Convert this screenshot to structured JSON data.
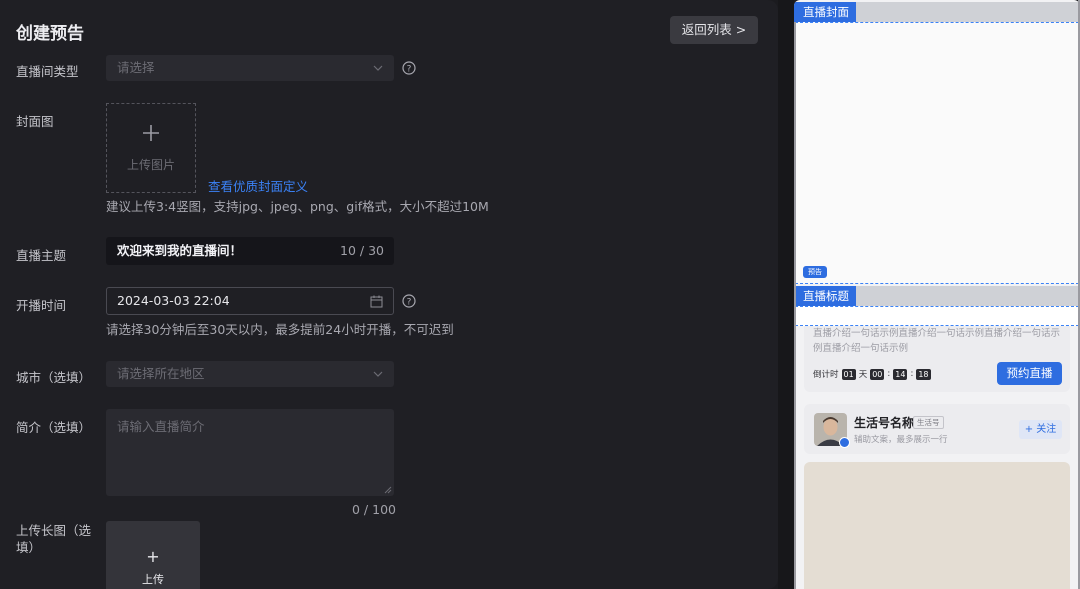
{
  "header": {
    "title": "创建预告",
    "back_label": "返回列表 >"
  },
  "form": {
    "room_type": {
      "label": "直播间类型",
      "placeholder": "请选择"
    },
    "cover": {
      "label": "封面图",
      "upload_text": "上传图片",
      "link": "查看优质封面定义",
      "hint": "建议上传3:4竖图，支持jpg、jpeg、png、gif格式，大小不超过10M"
    },
    "topic": {
      "label": "直播主题",
      "value": "欢迎来到我的直播间！",
      "count": "10 / 30"
    },
    "start_time": {
      "label": "开播时间",
      "value": "2024-03-03 22:04",
      "hint": "请选择30分钟后至30天以内，最多提前24小时开播，不可迟到"
    },
    "city": {
      "label": "城市（选填）",
      "placeholder": "请选择所在地区"
    },
    "intro": {
      "label": "简介（选填）",
      "placeholder": "请输入直播简介",
      "count": "0 / 100"
    },
    "long_image": {
      "label_line1": "上传长图（选",
      "label_line2": "填）",
      "plus": "+",
      "upload_text": "上传"
    }
  },
  "preview": {
    "cover_tag": "直播封面",
    "badge": "预告",
    "title_tag": "直播标题",
    "intro_text": "直播介绍一句话示例直播介绍一句话示例直播介绍一句话示例直播介绍一句话示例",
    "countdown": {
      "label": "倒计时",
      "days": "01",
      "day_unit": "天",
      "hours": "00",
      "minutes": "14",
      "seconds": "18",
      "sep": ":"
    },
    "reserve_label": "预约直播",
    "account": {
      "name": "生活号名称",
      "badge": "生活号",
      "sub": "辅助文案，最多展示一行",
      "follow_label": "+ 关注"
    }
  },
  "colors": {
    "accent": "#2e6de0",
    "link": "#3b82f6",
    "panel_bg": "#1f1f24",
    "field_bg": "#2a2a30"
  }
}
